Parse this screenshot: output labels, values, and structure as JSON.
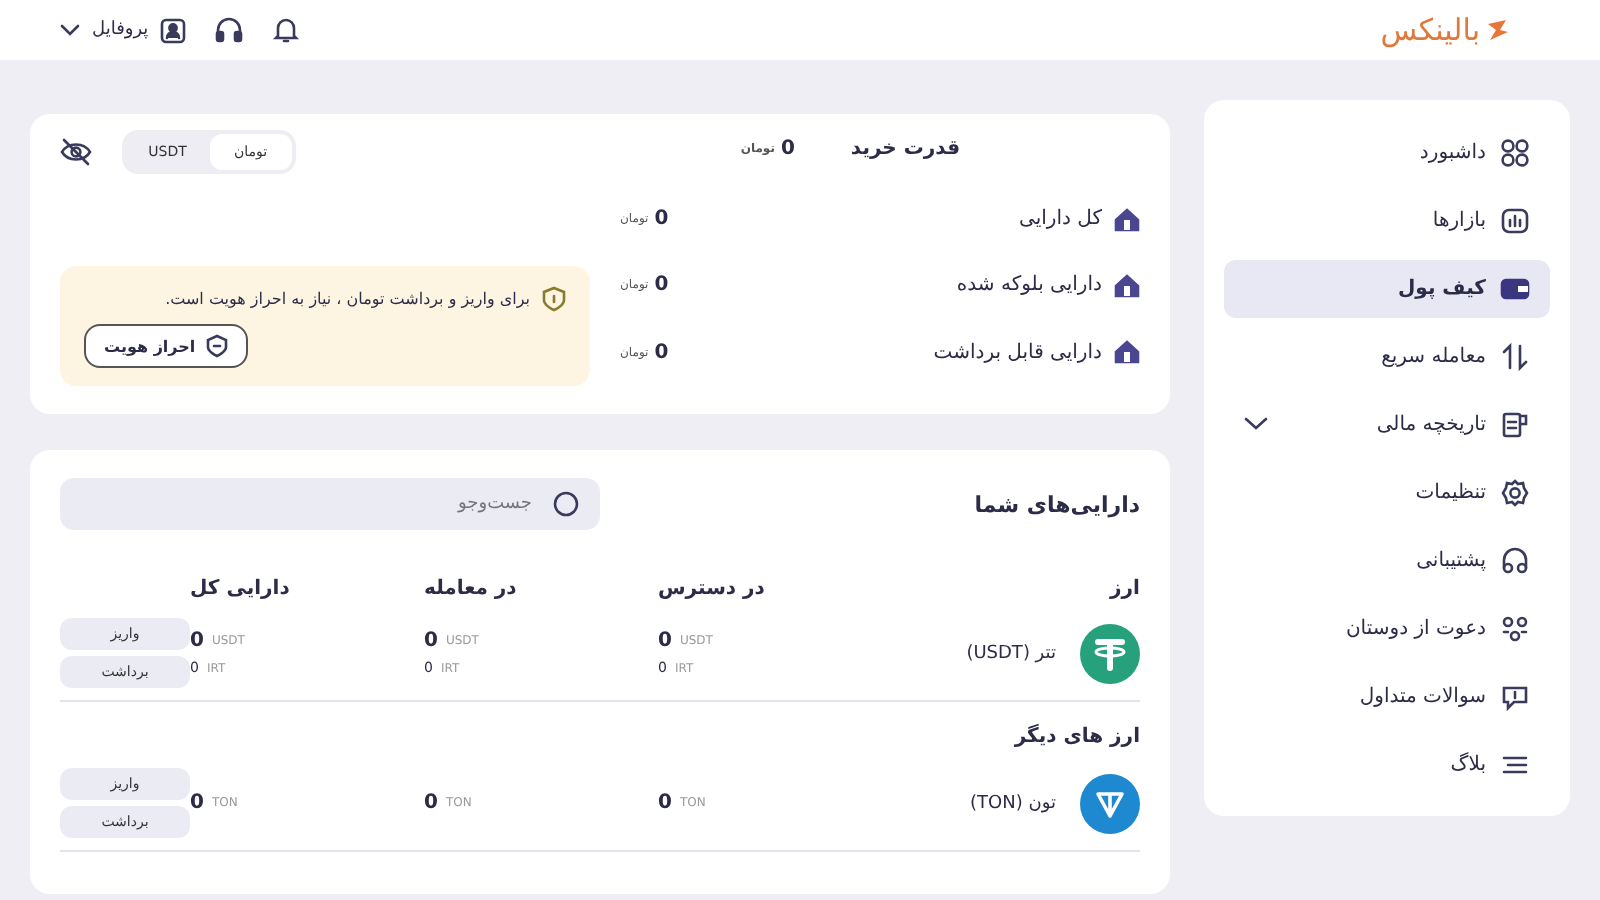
{
  "header": {
    "logo": "بالینکس",
    "profile": "پروفایل"
  },
  "sidebar": {
    "items": [
      {
        "label": "داشبورد",
        "selected": false,
        "has_submenu": false
      },
      {
        "label": "بازارها",
        "selected": false,
        "has_submenu": false
      },
      {
        "label": "کیف پول",
        "selected": true,
        "has_submenu": false
      },
      {
        "label": "معامله سریع",
        "selected": false,
        "has_submenu": false
      },
      {
        "label": "تاریخچه مالی",
        "selected": false,
        "has_submenu": true
      },
      {
        "label": "تنظیمات",
        "selected": false,
        "has_submenu": false
      },
      {
        "label": "پشتیبانی",
        "selected": false,
        "has_submenu": false
      },
      {
        "label": "دعوت از دوستان",
        "selected": false,
        "has_submenu": false
      },
      {
        "label": "سوالات متداول",
        "selected": false,
        "has_submenu": false
      },
      {
        "label": "بلاگ",
        "selected": false,
        "has_submenu": false
      }
    ]
  },
  "summary": {
    "purchase_power": {
      "label": "قدرت خرید",
      "value": "0",
      "unit": "تومان"
    },
    "currency_toggle": [
      {
        "label": "تومان",
        "selected": true
      },
      {
        "label": "USDT",
        "selected": false
      }
    ],
    "balances": [
      {
        "label": "کل دارایی",
        "value": "0",
        "unit": "تومان"
      },
      {
        "label": "دارایی بلوکه شده",
        "value": "0",
        "unit": "تومان"
      },
      {
        "label": "دارایی قابل برداشت",
        "value": "0",
        "unit": "تومان"
      }
    ],
    "notice": {
      "text": "برای واریز و برداشت تومان ، نیاز به احراز هویت است.",
      "button": "احراز هویت"
    }
  },
  "assets": {
    "title": "دارایی‌های شما",
    "search": {
      "placeholder": "جست‌وجو"
    },
    "columns": [
      "ارز",
      "در دسترس",
      "در معامله",
      "دارایی کل"
    ],
    "sections": [
      {
        "rows": [
          {
            "name": "تتر (USDT)",
            "kind": "usdt",
            "cells": [
              {
                "lines": [
                  {
                    "value": "0",
                    "unit": "USDT"
                  },
                  {
                    "value": "0",
                    "unit": "IRT"
                  }
                ]
              },
              {
                "lines": [
                  {
                    "value": "0",
                    "unit": "USDT"
                  },
                  {
                    "value": "0",
                    "unit": "IRT"
                  }
                ]
              },
              {
                "lines": [
                  {
                    "value": "0",
                    "unit": "USDT"
                  },
                  {
                    "value": "0",
                    "unit": "IRT"
                  }
                ]
              }
            ],
            "buttons": [
              "واریز",
              "برداشت"
            ]
          }
        ]
      },
      {
        "title": "ارز های دیگر",
        "rows": [
          {
            "name": "تون (TON)",
            "kind": "ton",
            "cells": [
              {
                "lines": [
                  {
                    "value": "0",
                    "unit": "TON"
                  }
                ]
              },
              {
                "lines": [
                  {
                    "value": "0",
                    "unit": "TON"
                  }
                ]
              },
              {
                "lines": [
                  {
                    "value": "0",
                    "unit": "TON"
                  }
                ]
              }
            ],
            "buttons": [
              "واریز",
              "برداشت"
            ]
          }
        ]
      }
    ]
  }
}
